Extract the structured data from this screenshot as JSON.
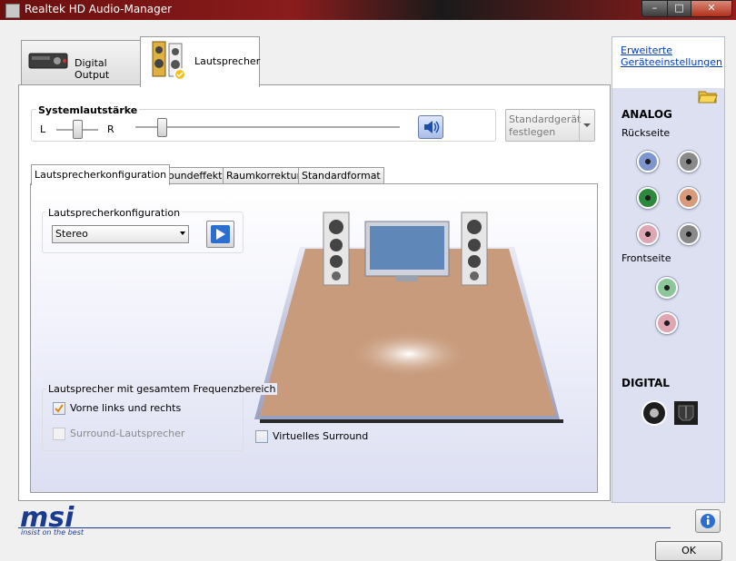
{
  "window": {
    "title": "Realtek HD Audio-Manager",
    "min_glyph": "–",
    "max_glyph": "□",
    "close_glyph": "✕"
  },
  "device_tabs": [
    {
      "label": "Digital Output",
      "icon": "digital-output-device-icon"
    },
    {
      "label": "Lautsprecher",
      "icon": "speakers-icon"
    }
  ],
  "volume": {
    "title": "Systemlautstärke",
    "left_label": "L",
    "right_label": "R",
    "balance": 0.5,
    "level": 0.1,
    "mute_icon": "speaker-volume-icon"
  },
  "default_device_button": {
    "line1": "Standardgerät",
    "line2": "festlegen"
  },
  "sub_tabs": [
    "Lautsprecherkonfiguration",
    "Soundeffekt",
    "Raumkorrektur",
    "Standardformat"
  ],
  "speaker_config": {
    "group_title": "Lautsprecherkonfiguration",
    "selected": "Stereo",
    "play_icon": "play-icon"
  },
  "full_range": {
    "group_title": "Lautsprecher mit gesamtem Frequenzbereich",
    "front": {
      "label": "Vorne links und rechts",
      "checked": true
    },
    "surround": {
      "label": "Surround-Lautsprecher",
      "checked": false,
      "enabled": false
    }
  },
  "virtual_surround": {
    "label": "Virtuelles Surround",
    "checked": false
  },
  "sidebar": {
    "advanced_link_line1": "Erweiterte",
    "advanced_link_line2": "Geräteeinstellungen",
    "folder_icon": "folder-icon",
    "analog_heading": "ANALOG",
    "rear_label": "Rückseite",
    "front_label": "Frontseite",
    "digital_heading": "DIGITAL",
    "rear_jacks": [
      "#7e96d0",
      "#8a8a8a",
      "#2d8a3c",
      "#d99a7a",
      "#e0a6b4",
      "#8a8a8a"
    ],
    "front_jacks": [
      "#8cc79a",
      "#e0a6b4"
    ]
  },
  "footer": {
    "brand": "msi",
    "tagline": "insist on the best",
    "ok_label": "OK",
    "info_icon": "info-icon"
  }
}
